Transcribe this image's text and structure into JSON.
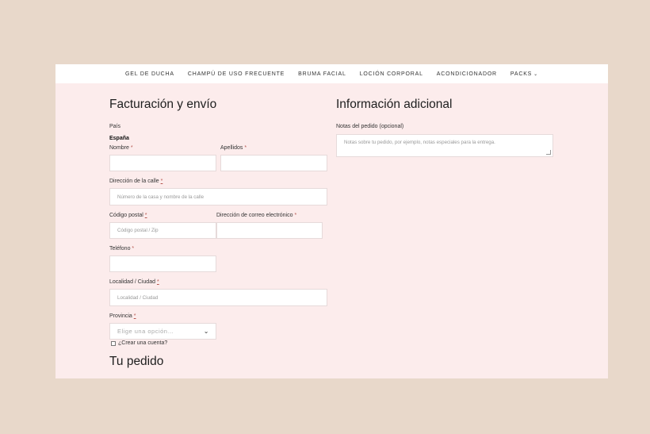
{
  "nav": {
    "items": [
      "GEL DE DUCHA",
      "CHAMPÚ DE USO FRECUENTE",
      "BRUMA FACIAL",
      "LOCIÓN CORPORAL",
      "ACONDICIONADOR",
      "PACKS"
    ],
    "packs_chevron": "⌄"
  },
  "billing": {
    "title": "Facturación y envío",
    "country_label": "País",
    "country_value": "España",
    "first_name_label": "Nombre",
    "last_name_label": "Apellidos",
    "street_label": "Dirección de la calle",
    "street_placeholder": "Número de la casa y nombre de la calle",
    "postcode_label": "Código postal",
    "postcode_placeholder": "Código postal / Zip",
    "email_label": "Dirección de correo electrónico",
    "phone_label": "Teléfono",
    "city_label": "Localidad / Ciudad",
    "city_placeholder": "Localidad / Ciudad",
    "province_label": "Provincia",
    "province_placeholder": "Elige una opción…",
    "create_account_label": "¿Crear una cuenta?",
    "required_mark": "*"
  },
  "additional": {
    "title": "Información adicional",
    "notes_label": "Notas del pedido (opcional)",
    "notes_placeholder": "Notas sobre tu pedido, por ejemplo, notas especiales para la entrega."
  },
  "order": {
    "title": "Tu pedido"
  }
}
